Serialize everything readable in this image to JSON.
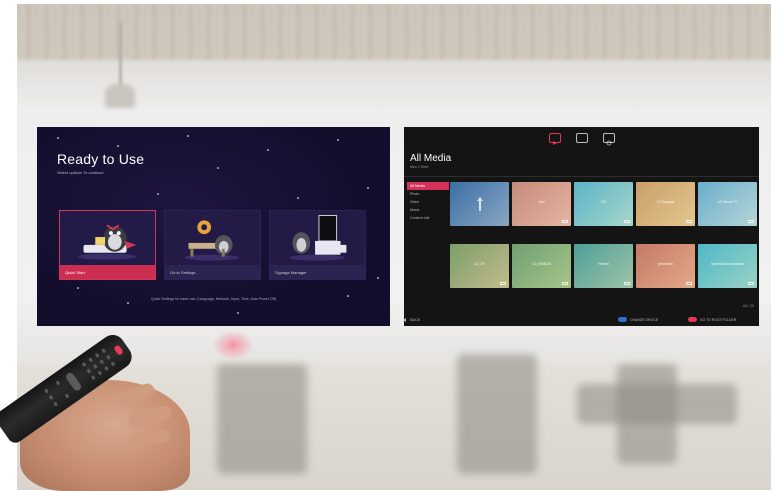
{
  "left_screen": {
    "title": "Ready to Use",
    "subtitle": "Select options To continue.",
    "cards": [
      {
        "label": "Quick Start",
        "icon": "penguin-reading-icon",
        "active": true
      },
      {
        "label": "Go to Settings",
        "icon": "gear-penguin-icon",
        "active": false
      },
      {
        "label": "Signage Manager",
        "icon": "monitor-penguin-icon",
        "active": false
      }
    ],
    "footer": "Quick Settings for basic use (Language, Network, Input, Time, Auto Power Off)"
  },
  "right_screen": {
    "top_icons": [
      "video-icon",
      "calendar-icon",
      "timer-icon"
    ],
    "title": "All Media",
    "subtitle": "Mex 2 Smrt",
    "categories": [
      {
        "label": "All Media",
        "active": true
      },
      {
        "label": "Photo",
        "active": false
      },
      {
        "label": "Video",
        "active": false
      },
      {
        "label": "Music",
        "active": false
      },
      {
        "label": "Content List",
        "active": false
      }
    ],
    "tiles": [
      {
        "label": "",
        "color_a": "#3a6fa3",
        "color_b": "#8aa6c4",
        "is_up": true
      },
      {
        "label": "Intro",
        "color_a": "#c58a7a",
        "color_b": "#e5b5a0",
        "is_up": false
      },
      {
        "label": "OK",
        "color_a": "#5ab4c9",
        "color_b": "#a8d6c8",
        "is_up": false
      },
      {
        "label": "LG Signage",
        "color_a": "#c89f6a",
        "color_b": "#e6c68e",
        "is_up": false
      },
      {
        "label": "LG Smart TV",
        "color_a": "#6aaecd",
        "color_b": "#b6d4d6",
        "is_up": false
      },
      {
        "label": "LG_0X",
        "color_a": "#7aa06a",
        "color_b": "#c4ba8a",
        "is_up": false
      },
      {
        "label": "LG_WEBOS",
        "color_a": "#6fa072",
        "color_b": "#a7c489",
        "is_up": false
      },
      {
        "label": "Reveal",
        "color_a": "#4e9e9a",
        "color_b": "#9fc4a6",
        "is_up": false
      },
      {
        "label": "promotion",
        "color_a": "#c57a66",
        "color_b": "#e4a886",
        "is_up": false
      },
      {
        "label": "SpecNewSonuddance",
        "color_a": "#4fb8c8",
        "color_b": "#9ad2c4",
        "is_up": false
      }
    ],
    "page_count": "4/1 / 20",
    "back_label": "BACK",
    "change_device_label": "CHANGE DEVICE",
    "root_folder_label": "GO TO ROOT FOLDER",
    "change_device_color": "#2f6fd8",
    "root_folder_color": "#e2365b"
  },
  "colors": {
    "accent": "#d03858",
    "left_bg": "#120d2b"
  }
}
